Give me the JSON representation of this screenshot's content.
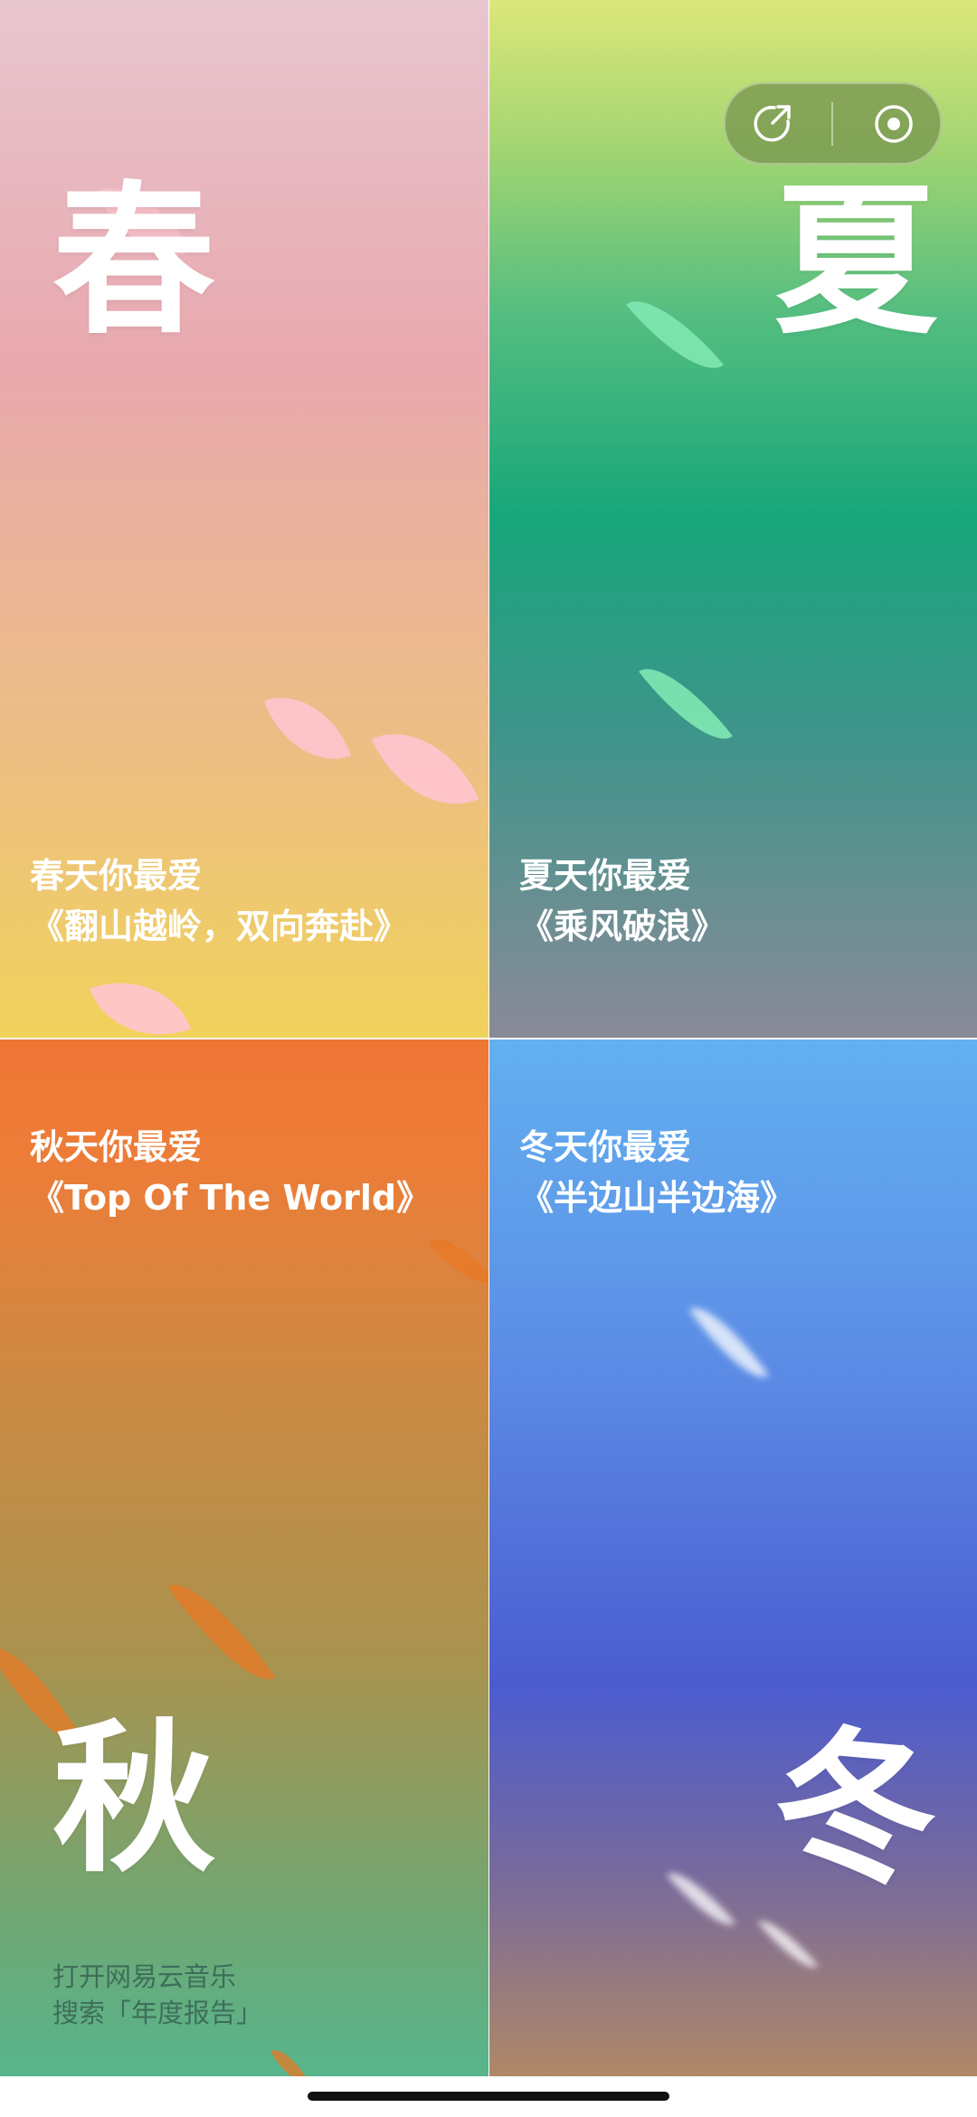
{
  "spring": {
    "season": "春",
    "caption_title": "春天你最爱",
    "caption_song": "《翻山越岭，双向奔赴》",
    "color": "#e8a8ae"
  },
  "summer": {
    "season": "夏",
    "caption_title": "夏天你最爱",
    "caption_song": "《乘风破浪》",
    "color": "#17a67a"
  },
  "autumn": {
    "season": "秋",
    "caption_title": "秋天你最爱",
    "caption_song": "《Top Of The World》",
    "color": "#ef7535"
  },
  "winter": {
    "season": "冬",
    "caption_title": "冬天你最爱",
    "caption_song": "《半边山半边海》",
    "color": "#4b5cd0"
  },
  "capsule": {
    "share_icon": "share-icon",
    "close_icon": "miniapp-close-icon"
  },
  "footer": {
    "line1": "打开网易云音乐",
    "line2": "搜索「年度报告」"
  }
}
